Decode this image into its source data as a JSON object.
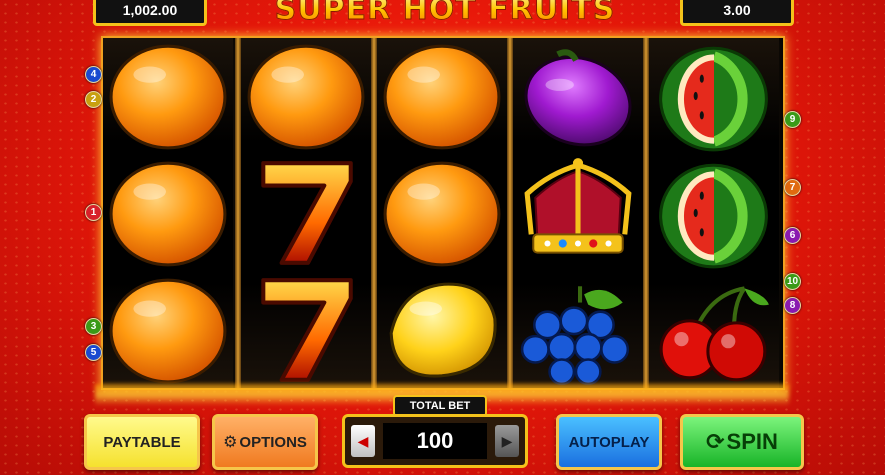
{
  "header": {
    "balance": "1,002.00",
    "game_title": "SUPER HOT FRUITS",
    "last_win": "3.00"
  },
  "reels": [
    [
      "orange",
      "orange",
      "orange"
    ],
    [
      "orange",
      "seven",
      "seven"
    ],
    [
      "orange",
      "orange",
      "lemon"
    ],
    [
      "plum",
      "crown",
      "grapes"
    ],
    [
      "watermelon",
      "watermelon",
      "cherries"
    ]
  ],
  "paylines": {
    "left": [
      "4",
      "2",
      "1",
      "3",
      "5"
    ],
    "right": [
      "9",
      "7",
      "6",
      "10",
      "8"
    ]
  },
  "controls": {
    "paytable_label": "PAYTABLE",
    "options_label": "OPTIONS",
    "total_bet_label": "TOTAL BET",
    "total_bet_value": "100",
    "autoplay_label": "AUTOPLAY",
    "spin_label": "SPIN"
  },
  "icons": {
    "options": "gear-icon",
    "spin": "refresh-arrows-icon",
    "bet_decrease": "triangle-left-icon",
    "bet_increase": "triangle-right-icon"
  },
  "colors": {
    "background": "#e8180a",
    "frame_gold": "#f4c21b",
    "paytable": "#f5e12e",
    "options": "#f07a20",
    "autoplay": "#1a6fe0",
    "spin": "#18b428"
  }
}
